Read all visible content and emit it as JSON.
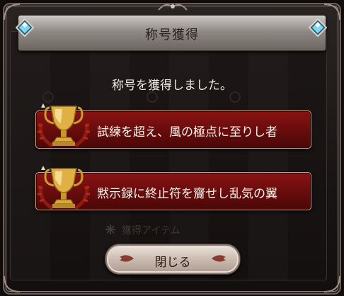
{
  "header": {
    "title": "称号獲得"
  },
  "message": "称号を獲得しました。",
  "titles": [
    {
      "label": "試練を超え、風の極点に至りし者",
      "icon": "gold-trophy-icon"
    },
    {
      "label": "黙示録に終止符を齎せし乱気の翼",
      "icon": "gold-trophy-icon"
    }
  ],
  "background": {
    "faded_section": "獲得アイテム"
  },
  "close_button": {
    "label": "閉じる"
  },
  "colors": {
    "title_bar": "#7a1010",
    "gold_border": "#c9a27a",
    "header_silver": "#a9a39e",
    "gem_blue": "#7fd7f2"
  }
}
